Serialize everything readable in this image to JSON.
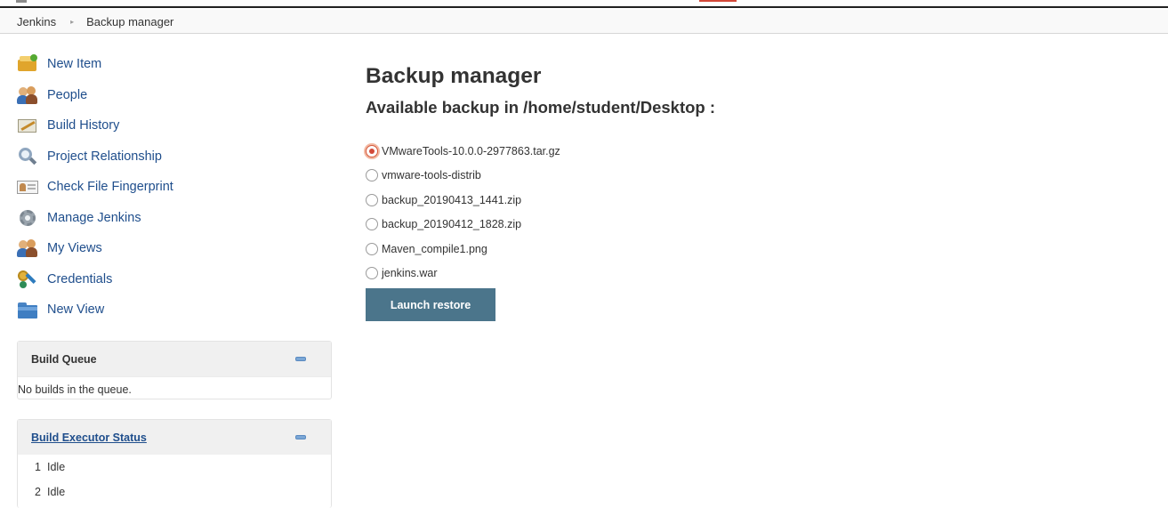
{
  "breadcrumb": {
    "items": [
      "Jenkins",
      "Backup manager"
    ],
    "separator": "▸"
  },
  "sidebar": {
    "tasks": [
      {
        "label": "New Item",
        "icon": "new-item-icon"
      },
      {
        "label": "People",
        "icon": "people-icon"
      },
      {
        "label": "Build History",
        "icon": "build-history-icon"
      },
      {
        "label": "Project Relationship",
        "icon": "search-icon"
      },
      {
        "label": "Check File Fingerprint",
        "icon": "fingerprint-icon"
      },
      {
        "label": "Manage Jenkins",
        "icon": "gear-icon"
      },
      {
        "label": "My Views",
        "icon": "people-icon"
      },
      {
        "label": "Credentials",
        "icon": "credentials-icon"
      },
      {
        "label": "New View",
        "icon": "folder-icon"
      }
    ]
  },
  "build_queue": {
    "title": "Build Queue",
    "empty_text": "No builds in the queue."
  },
  "executor_status": {
    "title": "Build Executor Status",
    "executors": [
      {
        "num": "1",
        "status": "Idle"
      },
      {
        "num": "2",
        "status": "Idle"
      }
    ]
  },
  "main": {
    "title": "Backup manager",
    "subtitle": "Available backup in /home/student/Desktop :",
    "backups": [
      {
        "name": "VMwareTools-10.0.0-2977863.tar.gz",
        "selected": true
      },
      {
        "name": "vmware-tools-distrib",
        "selected": false
      },
      {
        "name": "backup_20190413_1441.zip",
        "selected": false
      },
      {
        "name": "backup_20190412_1828.zip",
        "selected": false
      },
      {
        "name": "Maven_compile1.png",
        "selected": false
      },
      {
        "name": "jenkins.war",
        "selected": false
      }
    ],
    "launch_label": "Launch restore"
  },
  "colors": {
    "link": "#1f4e8c",
    "button": "#4b758b",
    "radio_selected": "#d24939"
  }
}
